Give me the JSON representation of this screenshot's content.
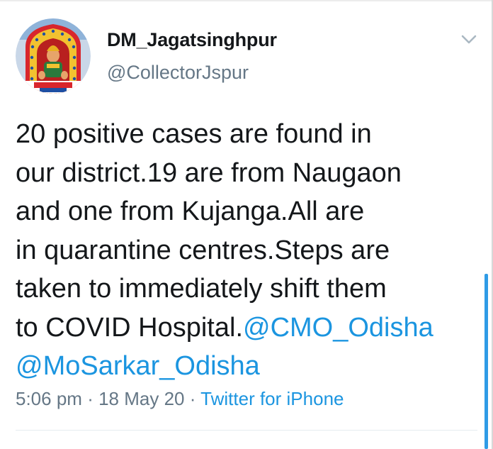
{
  "user": {
    "display_name": "DM_Jagatsinghpur",
    "handle": "@CollectorJspur",
    "avatar_icon": "temple-deity-avatar"
  },
  "tweet": {
    "lines": [
      {
        "text": "20 positive cases are found in"
      },
      {
        "text": "our district.19 are from Naugaon"
      },
      {
        "text": "and one from Kujanga.All are"
      },
      {
        "text": "in quarantine centres.Steps are"
      },
      {
        "text": "taken to immediately shift them"
      },
      {
        "text": "to COVID Hospital.",
        "mention": "@CMO_Odisha"
      },
      {
        "mention": "@MoSarkar_Odisha"
      }
    ]
  },
  "meta": {
    "time": "5:06 pm",
    "date": "18 May 20",
    "separator": "·",
    "source": "Twitter for iPhone"
  },
  "icons": {
    "menu": "chevron-down-icon"
  },
  "colors": {
    "link": "#1b95e0",
    "secondary_text": "#657786",
    "primary_text": "#14171a",
    "scrollbar": "#2f9be6"
  }
}
